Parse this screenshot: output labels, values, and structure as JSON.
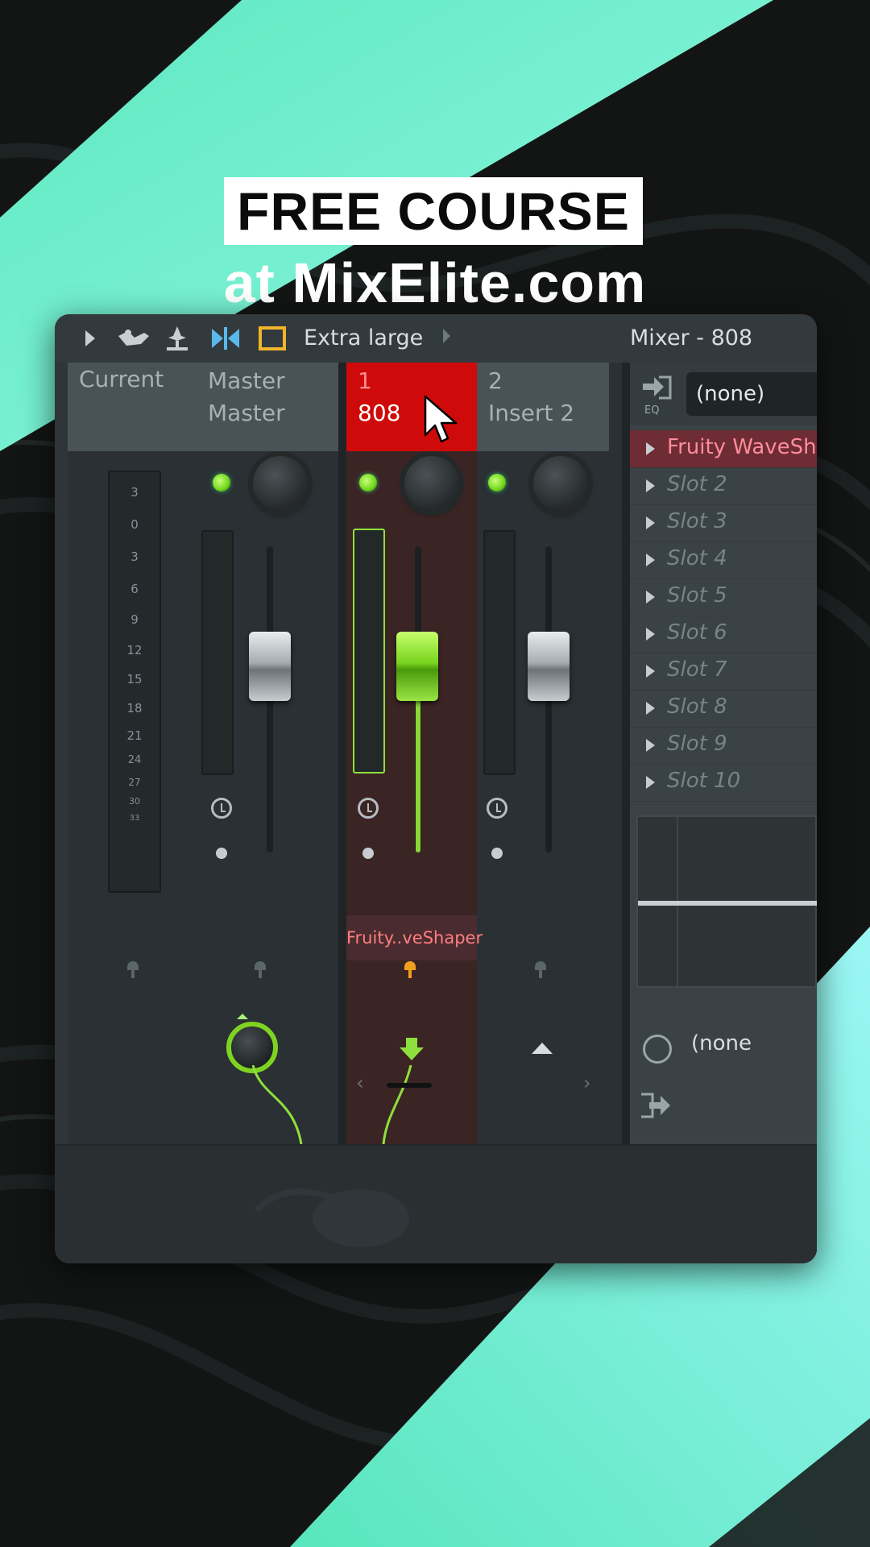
{
  "promo": {
    "title": "FREE COURSE",
    "subtitle": "at MixElite.com"
  },
  "colors": {
    "accent_mint": "#6ff2cf",
    "selected_track": "#cf0a0a",
    "led_green": "#7ed321",
    "fx_active": "#ff8c9a"
  },
  "toolbar": {
    "icons": [
      "play-arrow-icon",
      "bird-icon",
      "anchor-pin-icon",
      "dock-icon",
      "window-box-icon"
    ],
    "size_label": "Extra large",
    "window_title": "Mixer - 808"
  },
  "tracks": [
    {
      "num": "",
      "name": "Current"
    },
    {
      "num": "Master",
      "name": "Master"
    },
    {
      "num": "1",
      "name": "808"
    },
    {
      "num": "2",
      "name": "Insert 2"
    }
  ],
  "scale": [
    "3",
    "0",
    "3",
    "6",
    "9",
    "12",
    "15",
    "18",
    "21",
    "24",
    "27",
    "30",
    "33"
  ],
  "fx_strip_label": "Fruity..veShaper",
  "fx_panel": {
    "eq_label": "EQ",
    "input_select": "(none)",
    "slots": [
      "Fruity WaveShaper",
      "Slot 2",
      "Slot 3",
      "Slot 4",
      "Slot 5",
      "Slot 6",
      "Slot 7",
      "Slot 8",
      "Slot 9",
      "Slot 10"
    ],
    "output_select": "(none"
  },
  "pager": {
    "prev": "‹",
    "next": "›"
  }
}
